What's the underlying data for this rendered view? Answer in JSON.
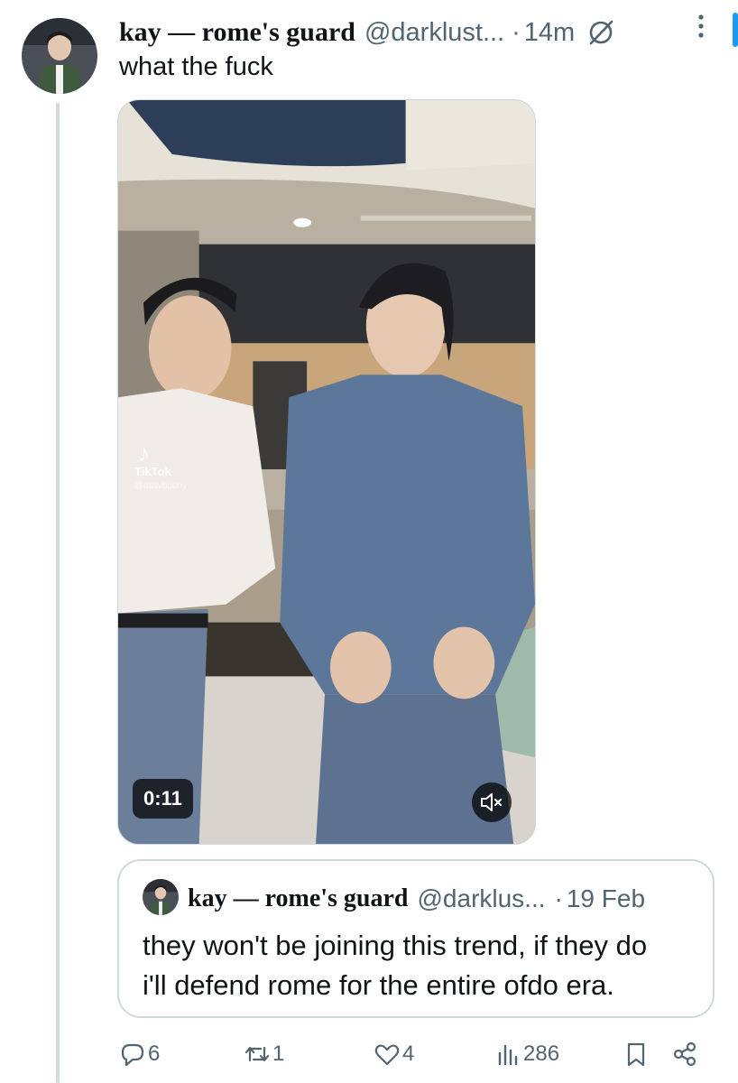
{
  "tweet": {
    "author_name": "kay — rome's guard",
    "handle": "@darklust...",
    "separator": "·",
    "time": "14m",
    "text": "what the fuck"
  },
  "media": {
    "type": "video",
    "duration": "0:11",
    "watermark": "TikTok",
    "watermark_handle": "@ossvbouny",
    "muted": true
  },
  "quoted_tweet": {
    "author_name": "kay — rome's guard",
    "handle": "@darklus...",
    "separator": "·",
    "date": "19 Feb",
    "text": "they won't be joining this trend, if they do\ni'll defend rome for the entire ofdo era."
  },
  "actions": {
    "replies": "6",
    "reposts": "1",
    "likes": "4",
    "views": "286"
  },
  "icons": [
    "grok-icon",
    "more-icon",
    "mute-icon",
    "reply-icon",
    "repost-icon",
    "like-icon",
    "views-icon",
    "bookmark-icon",
    "share-icon"
  ],
  "colors": {
    "secondary_text": "#536471",
    "border": "#cfd9de",
    "accent": "#1d9bf0"
  }
}
